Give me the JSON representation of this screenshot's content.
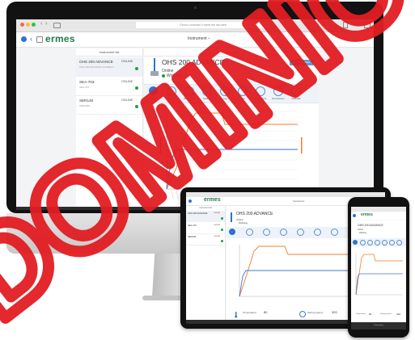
{
  "browser": {
    "url": "Cerca o inserisci il nome del sito web"
  },
  "app": {
    "logo": "ermes",
    "header_dropdown": "Instrument",
    "powered_by": "Powered by"
  },
  "sidebar": {
    "title": "Instrument list",
    "items": [
      {
        "name": "OHS 200 ADVANCE",
        "status": "ONLINE",
        "sub": "OHS 200 ADVANCE CONNECT"
      },
      {
        "name": "SEA-703",
        "status": "ONLINE",
        "sub": "SEA-703"
      },
      {
        "name": "SER148",
        "status": "ONLINE",
        "sub": "SER0005"
      }
    ]
  },
  "instrument": {
    "panel_title": "Instrument",
    "name": "OHS 200 ADVANCE",
    "status_line1": "Online",
    "status_line2": "Working",
    "action_label": "Edit instrument",
    "tabs": [
      "Status",
      "Analysis",
      "Work setup",
      "Settings",
      "Log",
      "Info",
      "Connectors",
      "Permissions",
      "Calibrate"
    ]
  },
  "mini_device": {
    "temperature_label": "Temperature",
    "temperature_value": "80",
    "stirring_label": "Stirring speed",
    "stirring_value": "320"
  },
  "colors": {
    "brand": "#1e7d46",
    "accent": "#2c73d2",
    "series_orange": "#f07d2a",
    "series_blue": "#3c78d8",
    "watermark": "#e21d23",
    "mac_bezel": "#121212",
    "mac_silver": "#d3d3d3"
  }
}
